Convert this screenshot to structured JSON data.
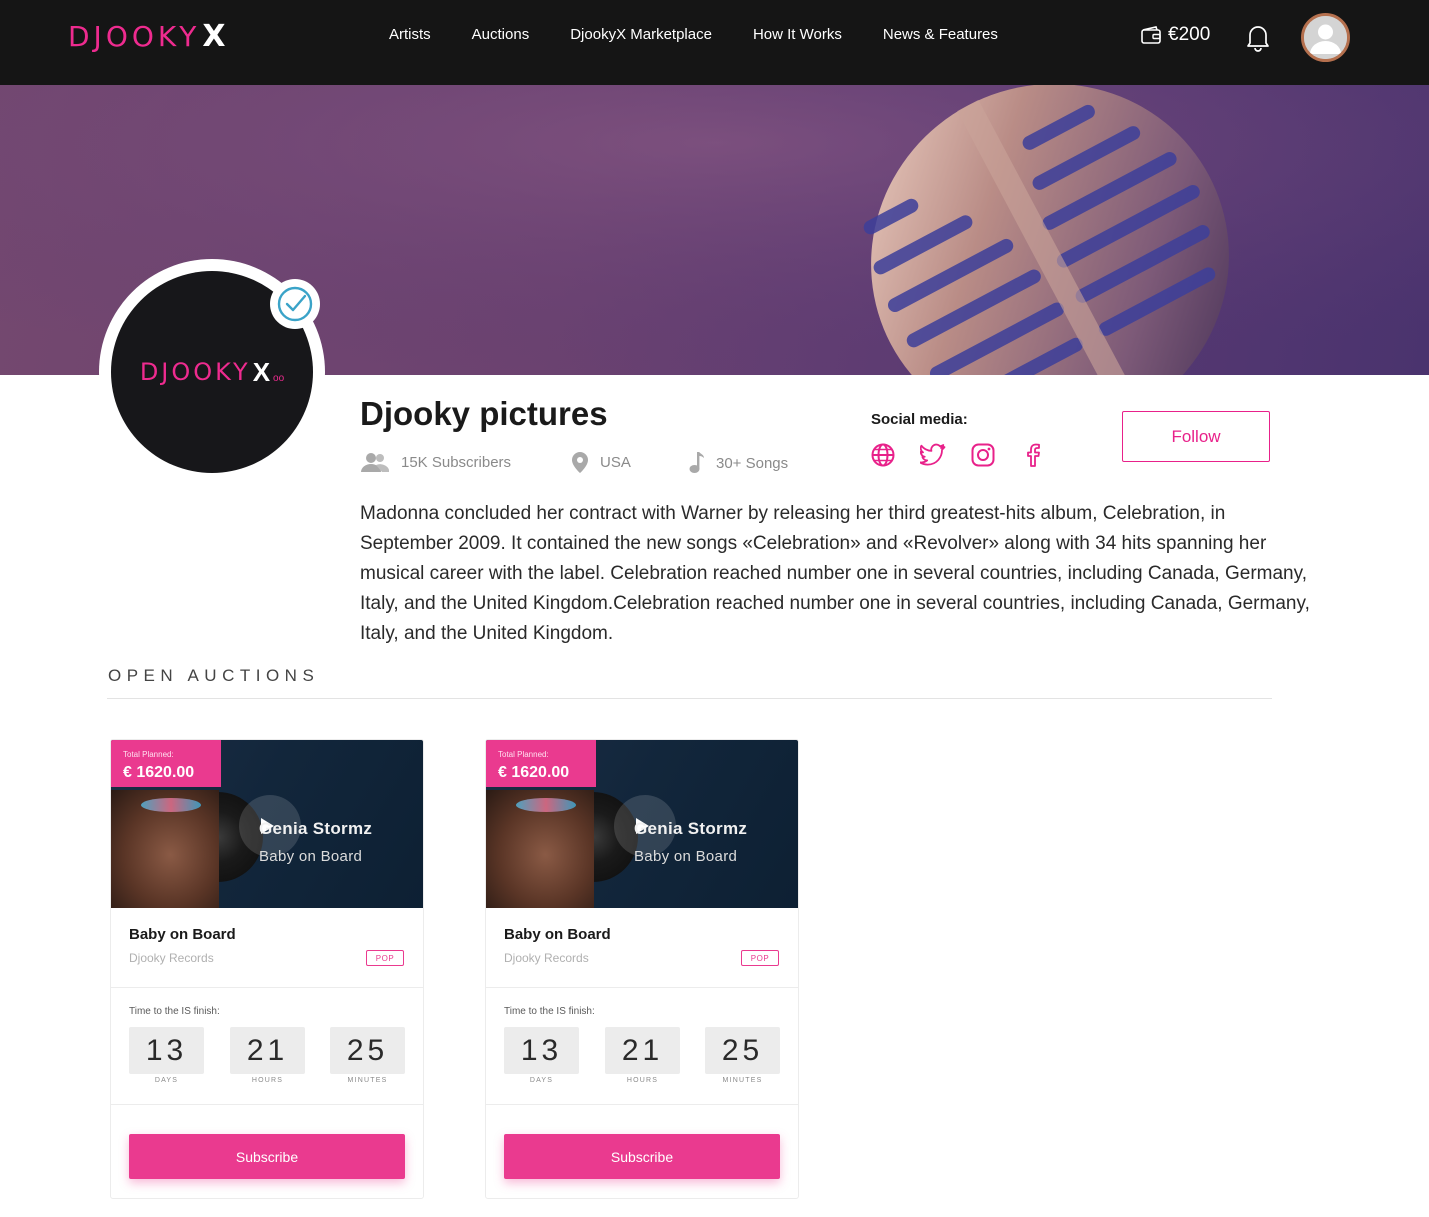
{
  "header": {
    "logo_text": "DJOOKY",
    "logo_mark": "X",
    "nav": [
      "Artists",
      "Auctions",
      "DjookyX Marketplace",
      "How It Works",
      "News & Features"
    ],
    "wallet_amount": "€200",
    "icons": [
      "wallet-icon",
      "bell-icon",
      "user-avatar-icon"
    ]
  },
  "profile": {
    "name": "Djooky pictures",
    "avatar_logo_text": "DJOOKY",
    "avatar_logo_mark": "X",
    "avatar_logo_dots": "oo",
    "subscribers": "15K Subscribers",
    "location": "USA",
    "songs": "30+ Songs",
    "social_label": "Social media:",
    "social_icons": [
      "globe-icon",
      "twitter-icon",
      "instagram-icon",
      "facebook-icon"
    ],
    "follow_label": "Follow",
    "bio": "Madonna concluded her contract with Warner by releasing her third greatest-hits album, Celebration, in September 2009. It contained the new songs «Celebration» and «Revolver» along with 34 hits spanning her musical career with the label. Celebration reached number one in several countries, including Canada, Germany, Italy, and the United Kingdom.Celebration reached number one in several countries, including Canada, Germany, Italy, and the United Kingdom."
  },
  "auctions": {
    "section_title": "OPEN AUCTIONS",
    "cards": [
      {
        "price_label": "Total Planned:",
        "price": "€ 1620.00",
        "media_artist": "Genia Stormz",
        "media_song": "Baby on Board",
        "title": "Baby on Board",
        "label": "Djooky Records",
        "genre": "POP",
        "timer_label": "Time to the IS finish:",
        "days": "13",
        "hours": "21",
        "minutes": "25",
        "days_unit": "DAYS",
        "hours_unit": "HOURS",
        "minutes_unit": "MINUTES",
        "button": "Subscribe"
      },
      {
        "price_label": "Total Planned:",
        "price": "€ 1620.00",
        "media_artist": "Genia Stormz",
        "media_song": "Baby on Board",
        "title": "Baby on Board",
        "label": "Djooky Records",
        "genre": "POP",
        "timer_label": "Time to the IS finish:",
        "days": "13",
        "hours": "21",
        "minutes": "25",
        "days_unit": "DAYS",
        "hours_unit": "HOURS",
        "minutes_unit": "MINUTES",
        "button": "Subscribe"
      }
    ]
  },
  "colors": {
    "accent": "#ea3a8f",
    "navbar": "#151515",
    "banner": "#6b4270"
  }
}
